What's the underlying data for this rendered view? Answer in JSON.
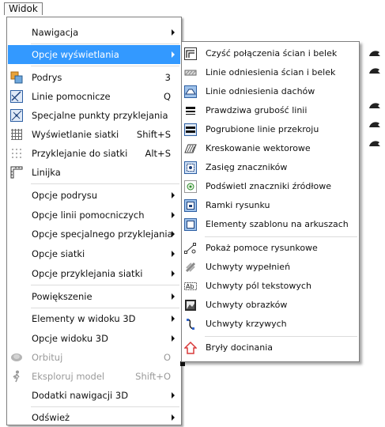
{
  "menubar": {
    "title": "Widok"
  },
  "menu": {
    "items": [
      {
        "label": "Nawigacja",
        "shortcut": "",
        "submenu": true,
        "icon": "",
        "highlighted": false,
        "disabled": false
      },
      {
        "label": "Opcje wyświetlania",
        "shortcut": "",
        "submenu": true,
        "icon": "",
        "highlighted": true,
        "disabled": false
      },
      {
        "label": "Podrys",
        "shortcut": "3",
        "submenu": false,
        "icon": "layers-icon",
        "highlighted": false,
        "disabled": false
      },
      {
        "label": "Linie pomocnicze",
        "shortcut": "Q",
        "submenu": false,
        "icon": "guide-lines-icon",
        "highlighted": false,
        "disabled": false
      },
      {
        "label": "Specjalne punkty przyklejania",
        "shortcut": "",
        "submenu": false,
        "icon": "snap-points-icon",
        "highlighted": false,
        "disabled": false
      },
      {
        "label": "Wyświetlanie siatki",
        "shortcut": "Shift+S",
        "submenu": false,
        "icon": "grid-icon",
        "highlighted": false,
        "disabled": false
      },
      {
        "label": "Przyklejanie do siatki",
        "shortcut": "Alt+S",
        "submenu": false,
        "icon": "snap-grid-icon",
        "highlighted": false,
        "disabled": false
      },
      {
        "label": "Linijka",
        "shortcut": "",
        "submenu": false,
        "icon": "ruler-icon",
        "highlighted": false,
        "disabled": false
      },
      {
        "label": "Opcje podrysu",
        "shortcut": "",
        "submenu": true,
        "icon": "",
        "highlighted": false,
        "disabled": false
      },
      {
        "label": "Opcje linii pomocniczych",
        "shortcut": "",
        "submenu": true,
        "icon": "",
        "highlighted": false,
        "disabled": false
      },
      {
        "label": "Opcje specjalnego przyklejania",
        "shortcut": "",
        "submenu": true,
        "icon": "",
        "highlighted": false,
        "disabled": false
      },
      {
        "label": "Opcje siatki",
        "shortcut": "",
        "submenu": true,
        "icon": "",
        "highlighted": false,
        "disabled": false
      },
      {
        "label": "Opcje przyklejania siatki",
        "shortcut": "",
        "submenu": true,
        "icon": "",
        "highlighted": false,
        "disabled": false
      },
      {
        "label": "Powiększenie",
        "shortcut": "",
        "submenu": true,
        "icon": "",
        "highlighted": false,
        "disabled": false
      },
      {
        "label": "Elementy w widoku 3D",
        "shortcut": "",
        "submenu": true,
        "icon": "",
        "highlighted": false,
        "disabled": false
      },
      {
        "label": "Opcje widoku 3D",
        "shortcut": "",
        "submenu": true,
        "icon": "",
        "highlighted": false,
        "disabled": false
      },
      {
        "label": "Orbituj",
        "shortcut": "O",
        "submenu": false,
        "icon": "orbit-icon",
        "highlighted": false,
        "disabled": true
      },
      {
        "label": "Eksploruj model",
        "shortcut": "Shift+O",
        "submenu": false,
        "icon": "walk-icon",
        "highlighted": false,
        "disabled": true
      },
      {
        "label": "Dodatki nawigacji 3D",
        "shortcut": "",
        "submenu": true,
        "icon": "",
        "highlighted": false,
        "disabled": false
      },
      {
        "label": "Odśwież",
        "shortcut": "",
        "submenu": true,
        "icon": "",
        "highlighted": false,
        "disabled": false
      }
    ]
  },
  "submenu": {
    "items": [
      {
        "label": "Czyść połączenia ścian i belek",
        "icon": "clean-joins-icon"
      },
      {
        "label": "Linie odniesienia ścian i belek",
        "icon": "wall-reference-icon"
      },
      {
        "label": "Linie odniesienia dachów",
        "icon": "roof-reference-icon"
      },
      {
        "label": "Prawdziwa grubość linii",
        "icon": "true-line-weight-icon"
      },
      {
        "label": "Pogrubione linie przekroju",
        "icon": "bold-section-lines-icon"
      },
      {
        "label": "Kreskowanie wektorowe",
        "icon": "vector-hatch-icon"
      },
      {
        "label": "Zasięg znaczników",
        "icon": "marker-range-icon"
      },
      {
        "label": "Podświetl znaczniki źródłowe",
        "icon": "highlight-source-icon"
      },
      {
        "label": "Ramki rysunku",
        "icon": "drawing-frames-icon"
      },
      {
        "label": "Elementy szablonu na arkuszach",
        "icon": "master-items-icon"
      },
      {
        "label": "Pokaż pomoce rysunkowe",
        "icon": "drawing-aids-icon"
      },
      {
        "label": "Uchwyty wypełnień",
        "icon": "fill-handles-icon"
      },
      {
        "label": "Uchwyty pól tekstowych",
        "icon": "text-handles-icon"
      },
      {
        "label": "Uchwyty obrazków",
        "icon": "image-handles-icon"
      },
      {
        "label": "Uchwyty krzywych",
        "icon": "curve-handles-icon"
      },
      {
        "label": "Bryły docinania",
        "icon": "trim-body-icon"
      }
    ]
  },
  "colors": {
    "highlight": "#3399ff",
    "disabled": "#9a9a9a"
  }
}
